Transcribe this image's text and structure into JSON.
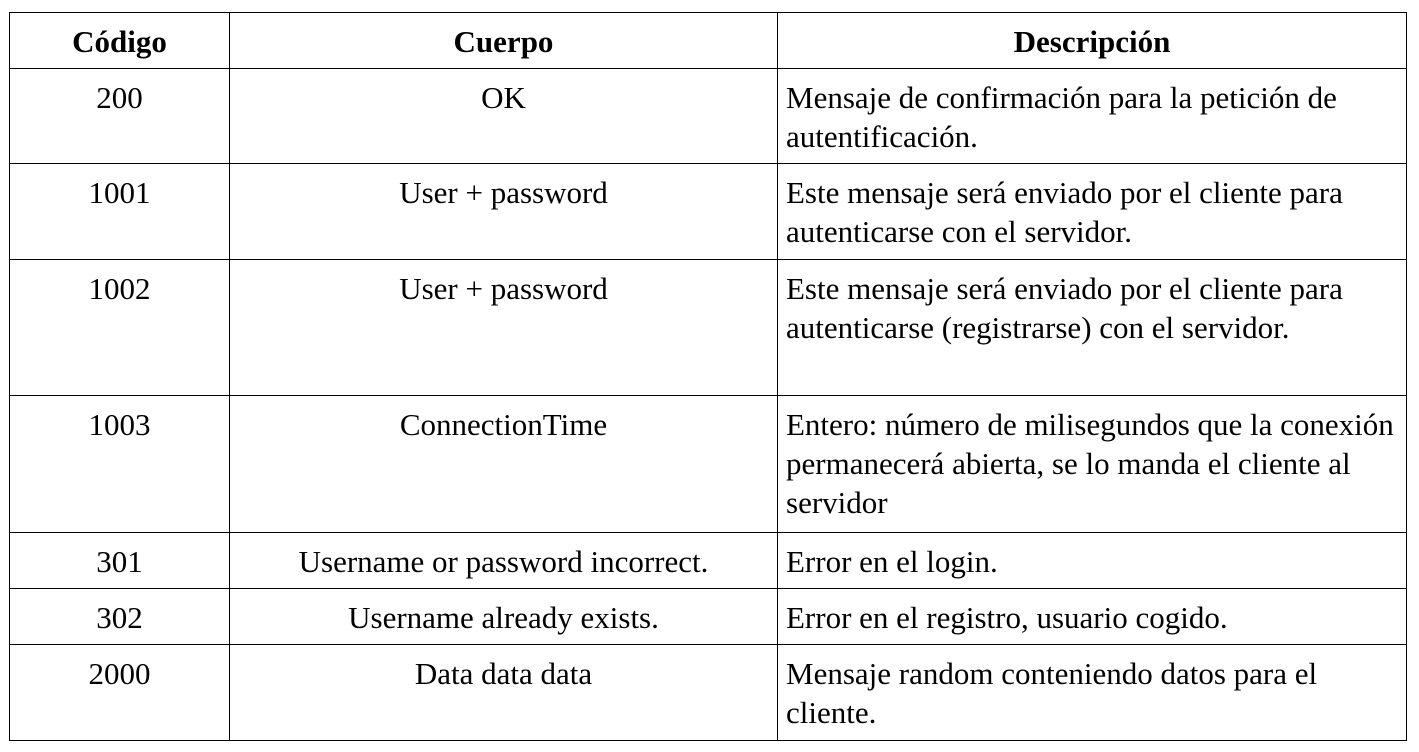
{
  "table": {
    "headers": [
      "Código",
      "Cuerpo",
      "Descripción"
    ],
    "rows": [
      {
        "code": "200",
        "body": "OK",
        "description": "Mensaje de confirmación para la petición de autentificación."
      },
      {
        "code": "1001",
        "body": "User + password",
        "description": "Este mensaje será enviado por el cliente para autenticarse con el servidor."
      },
      {
        "code": "1002",
        "body": "User + password",
        "description": "Este mensaje será enviado por el cliente para autenticarse (registrarse) con el servidor."
      },
      {
        "code": "1003",
        "body": "ConnectionTime",
        "description": "Entero: número de milisegundos que la conexión permanecerá abierta, se lo manda el cliente al servidor"
      },
      {
        "code": "301",
        "body": "Username or password incorrect.",
        "description": "Error en el login."
      },
      {
        "code": "302",
        "body": "Username already exists.",
        "description": "Error en el registro, usuario cogido."
      },
      {
        "code": "2000",
        "body": "Data data data",
        "description": "Mensaje random conteniendo datos para el cliente."
      }
    ]
  }
}
